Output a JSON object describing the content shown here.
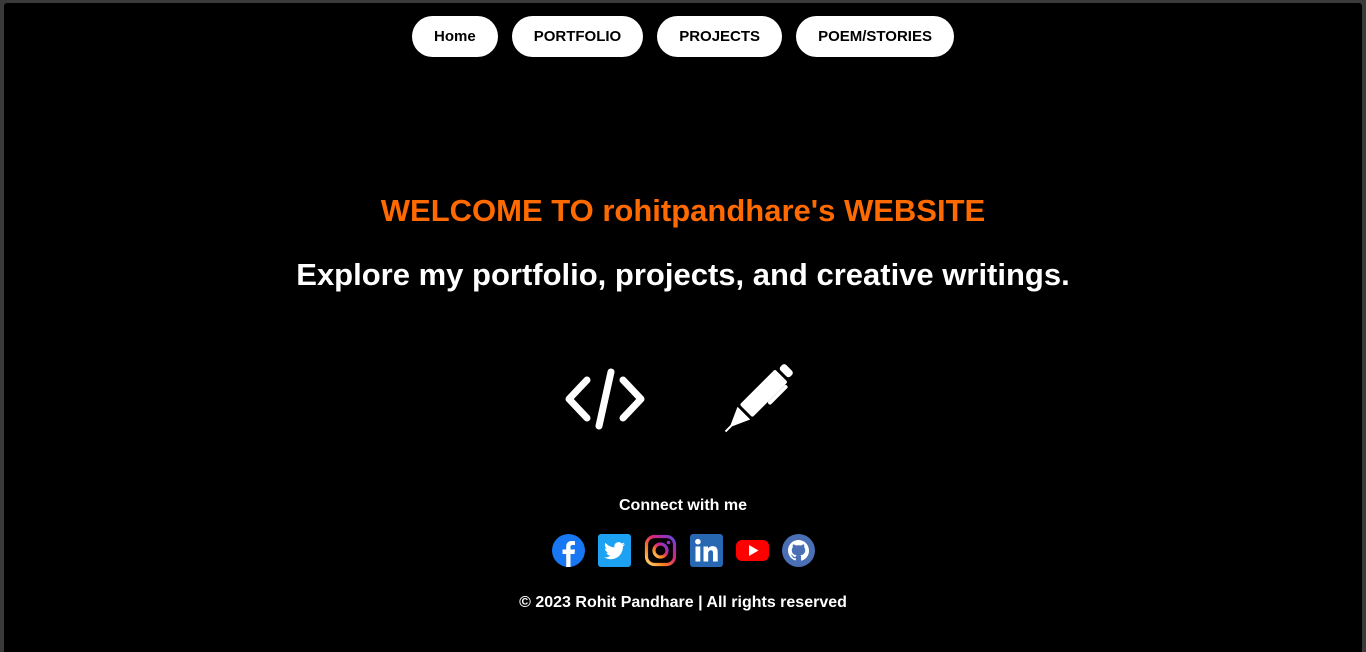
{
  "nav": {
    "items": [
      {
        "label": "Home"
      },
      {
        "label": "PORTFOLIO"
      },
      {
        "label": "PROJECTS"
      },
      {
        "label": "POEM/STORIES"
      }
    ]
  },
  "hero": {
    "welcome": "WELCOME TO rohitpandhare's WEBSITE",
    "tagline": "Explore my portfolio, projects, and creative writings."
  },
  "feature_icons": [
    "code-icon",
    "pen-icon"
  ],
  "connect": {
    "label": "Connect with me",
    "socials": [
      "facebook-icon",
      "twitter-icon",
      "instagram-icon",
      "linkedin-icon",
      "youtube-icon",
      "github-icon"
    ]
  },
  "footer": {
    "text": "© 2023 Rohit Pandhare | All rights reserved"
  },
  "colors": {
    "background": "#000000",
    "accent": "#ff6a00",
    "nav_button_bg": "#ffffff",
    "facebook": "#1877f2",
    "twitter": "#1da1f2",
    "linkedin": "#2867b2",
    "youtube": "#ff0000",
    "github": "#4a6fb5"
  }
}
